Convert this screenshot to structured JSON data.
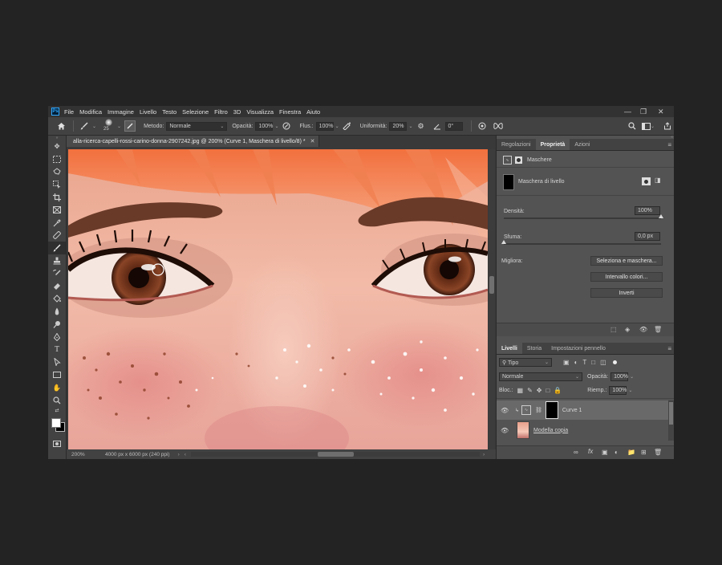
{
  "menu": {
    "items": [
      "File",
      "Modifica",
      "Immagine",
      "Livello",
      "Testo",
      "Selezione",
      "Filtro",
      "3D",
      "Visualizza",
      "Finestra",
      "Aiuto"
    ]
  },
  "options": {
    "brush_size": "25",
    "method_label": "Metodo:",
    "method_value": "Normale",
    "opacity_label": "Opacità:",
    "opacity_value": "100%",
    "flow_label": "Flus.:",
    "flow_value": "100%",
    "smoothing_label": "Uniformità:",
    "smoothing_value": "20%",
    "angle_value": "0°"
  },
  "document": {
    "tab_title": "alla-ricerca-capelli-rossi-carino-donna-2907242.jpg @ 200% (Curve 1, Maschera di livello/8) *",
    "zoom": "200%",
    "doc_info": "4000 px x 6000 px (240 ppi)"
  },
  "properties_panel": {
    "tabs": [
      "Regolazioni",
      "Proprietà",
      "Azioni"
    ],
    "active_tab": "Proprietà",
    "section": "Maschere",
    "mask_name": "Maschera di livello",
    "density_label": "Densità:",
    "density_value": "100%",
    "density_level": 1.0,
    "feather_label": "Sfuma:",
    "feather_value": "0,0 px",
    "feather_level": 0.0,
    "refine_label": "Migliora:",
    "buttons": [
      "Seleziona e maschera...",
      "Intervallo colori...",
      "Inverti"
    ]
  },
  "layers_panel": {
    "tabs": [
      "Livelli",
      "Storia",
      "Impostazioni pennello"
    ],
    "active_tab": "Livelli",
    "filter_kind": "Tipo",
    "blend_mode": "Normale",
    "opacity_label": "Opacità:",
    "opacity_value": "100%",
    "lock_label": "Bloc.:",
    "fill_label": "Riemp.:",
    "fill_value": "100%",
    "layers": [
      {
        "name": "Curve 1"
      },
      {
        "name": "Modella copia"
      }
    ]
  },
  "colors": {
    "accent": "#31a8ff",
    "panel_bg": "#535353",
    "dark_bg": "#232323"
  }
}
